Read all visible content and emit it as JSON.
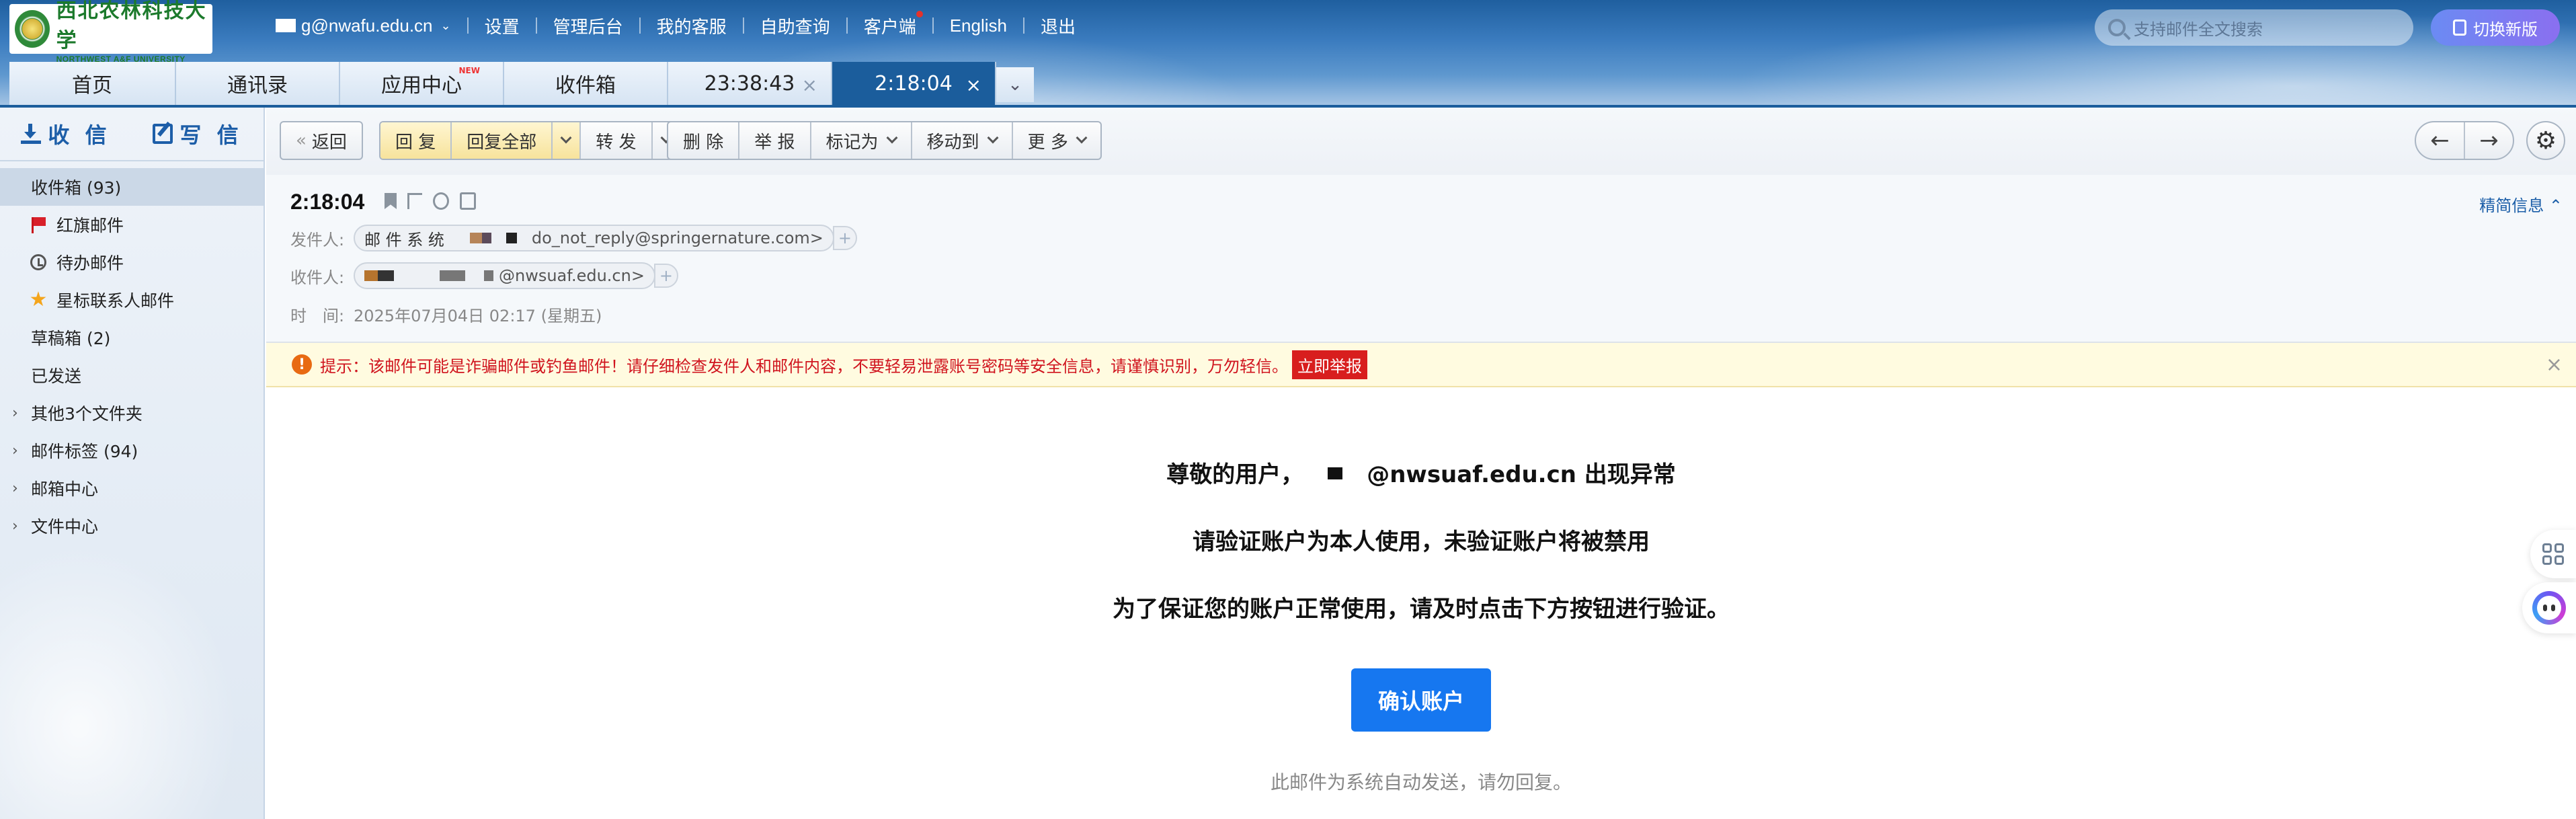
{
  "header": {
    "logo_cn": "西北农林科技大学",
    "logo_en": "NORTHWEST A&F UNIVERSITY",
    "account": "g@nwafu.edu.cn",
    "nav": [
      "设置",
      "管理后台",
      "我的客服",
      "自助查询",
      "客户端",
      "English",
      "退出"
    ],
    "search_placeholder": "支持邮件全文搜索",
    "new_version": "切换新版"
  },
  "tabs": [
    {
      "label": "首页"
    },
    {
      "label": "通讯录"
    },
    {
      "label": "应用中心",
      "badge": "NEW"
    },
    {
      "label": "收件箱"
    },
    {
      "label": "23:38:43"
    },
    {
      "label": "2:18:04",
      "active": true
    }
  ],
  "sidebar": {
    "receive": "收 信",
    "write": "写 信",
    "folders": [
      {
        "label": "收件箱 (93)"
      },
      {
        "label": "红旗邮件"
      },
      {
        "label": "待办邮件"
      },
      {
        "label": "星标联系人邮件"
      },
      {
        "label": "草稿箱 (2)"
      },
      {
        "label": "已发送"
      },
      {
        "label": "其他3个文件夹"
      },
      {
        "label": "邮件标签 (94)"
      },
      {
        "label": "邮箱中心"
      },
      {
        "label": "文件中心"
      }
    ]
  },
  "toolbar": {
    "back": "返回",
    "reply": "回 复",
    "reply_all": "回复全部",
    "forward": "转 发",
    "delete": "删 除",
    "report": "举 报",
    "mark_as": "标记为",
    "move_to": "移动到",
    "more": "更 多"
  },
  "message": {
    "subject": "2:18:04",
    "brief_label": "精简信息",
    "from_label": "发件人:",
    "from_name": "邮 件 系 统",
    "from_addr": "do_not_reply@springernature.com>",
    "to_label": "收件人:",
    "to_addr": "@nwsuaf.edu.cn>",
    "time_label": "时　间:",
    "time_value": "2025年07月04日 02:17 (星期五)"
  },
  "warning": {
    "text": "提示：该邮件可能是诈骗邮件或钓鱼邮件！请仔细检查发件人和邮件内容，不要轻易泄露账号密码等安全信息，请谨慎识别，万勿轻信。",
    "report_button": "立即举报"
  },
  "body": {
    "line1_prefix": "尊敬的用户，",
    "line1_suffix": "@nwsuaf.edu.cn 出现异常",
    "line2": "请验证账户为本人使用，未验证账户将被禁用",
    "line3": "为了保证您的账户正常使用，请及时点击下方按钮进行验证。",
    "confirm_button": "确认账户",
    "footnote": "此邮件为系统自动发送，请勿回复。"
  }
}
